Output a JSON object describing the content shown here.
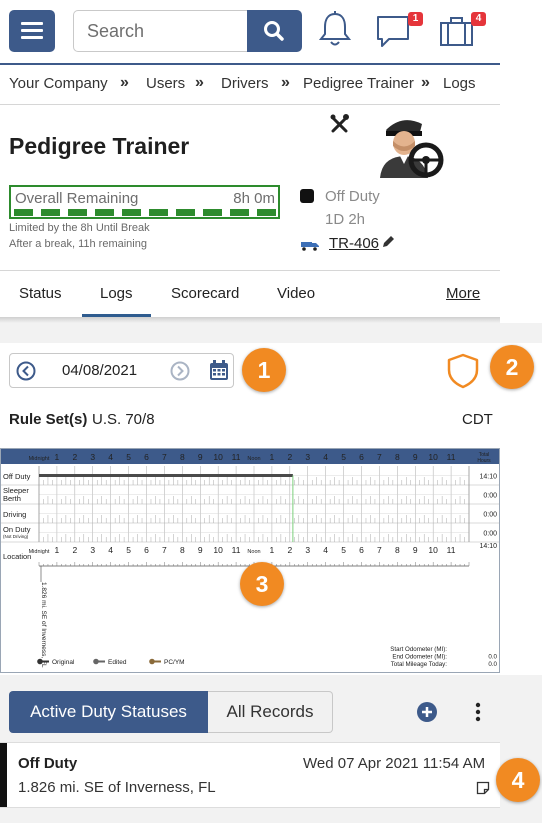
{
  "header": {
    "search_placeholder": "Search",
    "notifications_icon": "bell-icon",
    "messages_badge": "1",
    "dispatch_badge": "4"
  },
  "breadcrumb": [
    "Your Company",
    "Users",
    "Drivers",
    "Pedigree Trainer",
    "Logs"
  ],
  "profile": {
    "name": "Pedigree Trainer",
    "remaining_label": "Overall Remaining",
    "remaining_value": "8h 0m",
    "remaining_fraction": 1.0,
    "limit_note": "Limited by the 8h Until Break",
    "break_note": "After a break, 11h remaining",
    "duty_status": "Off Duty",
    "duty_duration": "1D 2h",
    "vehicle": "TR-406"
  },
  "tabs": [
    "Status",
    "Logs",
    "Scorecard",
    "Video",
    "More"
  ],
  "date_bar": {
    "date": "04/08/2021",
    "ruleset_label": "Rule Set(s)",
    "ruleset_value": "U.S. 70/8",
    "timezone": "CDT"
  },
  "callouts": [
    "1",
    "2",
    "3",
    "4"
  ],
  "log_grid": {
    "hour_labels": [
      "Midnight",
      "1",
      "2",
      "3",
      "4",
      "5",
      "6",
      "7",
      "8",
      "9",
      "10",
      "11",
      "Noon",
      "1",
      "2",
      "3",
      "4",
      "5",
      "6",
      "7",
      "8",
      "9",
      "10",
      "11"
    ],
    "total_header": "Total Hours",
    "rows": [
      {
        "label": "Off Duty",
        "sub": "",
        "total": "14:10"
      },
      {
        "label": "Sleeper Berth",
        "sub": "",
        "total": "0:00"
      },
      {
        "label": "Driving",
        "sub": "",
        "total": "0:00"
      },
      {
        "label": "On Duty",
        "sub": "(Not Driving)",
        "total": "0:00"
      }
    ],
    "grand_total": "14:10",
    "location_label": "Location",
    "location_entry": "1.826 mi. SE of Inverness, FL",
    "legend": [
      "Original",
      "Edited",
      "PC/YM"
    ],
    "odometer": [
      {
        "label": "Start Odometer (MI):",
        "value": ""
      },
      {
        "label": "End Odometer (MI):",
        "value": "0.0"
      },
      {
        "label": "Total Mileage Today:",
        "value": "0.0"
      }
    ],
    "off_duty_until_hour": 14.17
  },
  "statuses": {
    "active_label": "Active Duty Statuses",
    "all_label": "All Records",
    "record": {
      "status": "Off Duty",
      "timestamp": "Wed 07 Apr 2021 11:54 AM",
      "location": "1.826 mi. SE of Inverness, FL"
    }
  },
  "colors": {
    "primary": "#3d5a8a",
    "remaining_green": "#2d8b2d",
    "callout_orange": "#f18a22",
    "badge_red": "#e5353b"
  }
}
